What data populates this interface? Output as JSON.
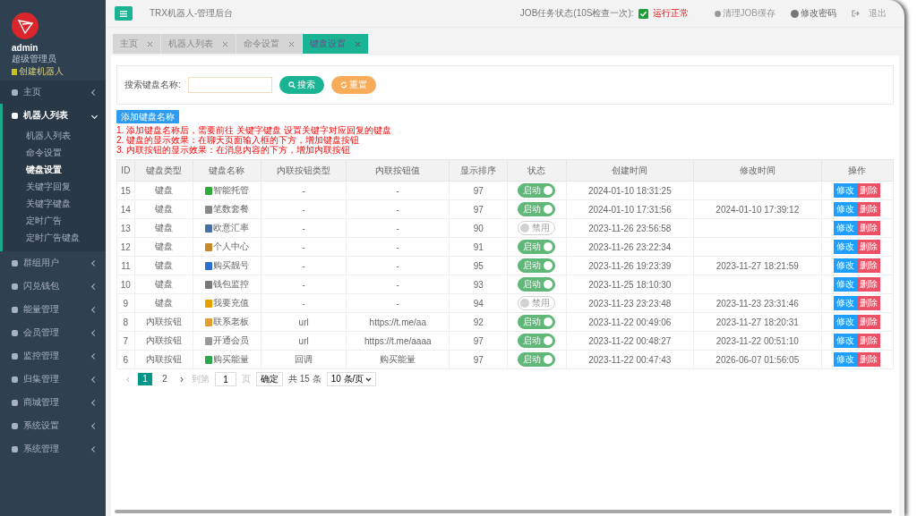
{
  "sidebar": {
    "user": {
      "name": "admin",
      "role": "超级管理员",
      "link": "创建机器人"
    },
    "items": [
      {
        "label": "主页",
        "expanded": false
      },
      {
        "label": "机器人列表",
        "expanded": true,
        "children": [
          {
            "label": "机器人列表",
            "selected": false
          },
          {
            "label": "命令设置",
            "selected": false
          },
          {
            "label": "键盘设置",
            "selected": true
          },
          {
            "label": "关键字回复",
            "selected": false
          },
          {
            "label": "关键字键盘",
            "selected": false
          },
          {
            "label": "定时广告",
            "selected": false
          },
          {
            "label": "定时广告键盘",
            "selected": false
          }
        ]
      },
      {
        "label": "群组用户",
        "expanded": false
      },
      {
        "label": "闪兑钱包",
        "expanded": false
      },
      {
        "label": "能量管理",
        "expanded": false
      },
      {
        "label": "会员管理",
        "expanded": false
      },
      {
        "label": "监控管理",
        "expanded": false
      },
      {
        "label": "归集管理",
        "expanded": false
      },
      {
        "label": "商城管理",
        "expanded": false
      },
      {
        "label": "系统设置",
        "expanded": false
      },
      {
        "label": "系统管理",
        "expanded": false
      }
    ]
  },
  "header": {
    "title": "TRX机器人-管理后台",
    "job_label": "JOB任务状态(10S检查一次):",
    "job_ok": true,
    "job_status": "运行正常",
    "clear_cache": "清理JOB缓存",
    "change_password": "修改密码",
    "logout": "退出"
  },
  "tabs": [
    {
      "label": "主页",
      "selected": false
    },
    {
      "label": "机器人列表",
      "selected": false
    },
    {
      "label": "命令设置",
      "selected": false
    },
    {
      "label": "键盘设置",
      "selected": true
    }
  ],
  "search": {
    "label": "搜索键盘名称:",
    "search_button": "搜索",
    "reset_button": "重置"
  },
  "add_button": "添加键盘名称",
  "notes": [
    "1. 添加键盘名称后，需要前往 关键字键盘 设置关键字对应回复的键盘",
    "2. 键盘的显示效果：在聊天页面输入框的下方，增加键盘按钮",
    "3. 内联按钮的显示效果：在消息内容的下方，增加内联按钮"
  ],
  "table": {
    "columns": [
      "ID",
      "键盘类型",
      "键盘名称",
      "内联按钮类型",
      "内联按钮值",
      "显示排序",
      "状态",
      "创建时间",
      "修改时间",
      "操作"
    ],
    "rows": [
      {
        "id": "15",
        "type": "键盘",
        "name": "智能托管",
        "button_type": "-",
        "button_value": "-",
        "order": "97",
        "on": true,
        "status": "启动",
        "created": "2024-01-10 18:31:25",
        "modified": "",
        "edit": "修改",
        "delete": "删除"
      },
      {
        "id": "14",
        "type": "键盘",
        "name": "笔数套餐",
        "button_type": "-",
        "button_value": "-",
        "order": "97",
        "on": true,
        "status": "启动",
        "created": "2024-01-10 17:31:56",
        "modified": "2024-01-10 17:39:12",
        "edit": "修改",
        "delete": "删除"
      },
      {
        "id": "13",
        "type": "键盘",
        "name": "欧意汇率",
        "button_type": "-",
        "button_value": "-",
        "order": "90",
        "on": false,
        "status": "禁用",
        "created": "2023-11-26 23:56:58",
        "modified": "",
        "edit": "修改",
        "delete": "删除"
      },
      {
        "id": "12",
        "type": "键盘",
        "name": "个人中心",
        "button_type": "-",
        "button_value": "-",
        "order": "91",
        "on": true,
        "status": "启动",
        "created": "2023-11-26 23:22:34",
        "modified": "",
        "edit": "修改",
        "delete": "删除"
      },
      {
        "id": "11",
        "type": "键盘",
        "name": "购买靓号",
        "button_type": "-",
        "button_value": "-",
        "order": "95",
        "on": true,
        "status": "启动",
        "created": "2023-11-26 19:23:39",
        "modified": "2023-11-27 18:21:59",
        "edit": "修改",
        "delete": "删除"
      },
      {
        "id": "10",
        "type": "键盘",
        "name": "钱包监控",
        "button_type": "-",
        "button_value": "-",
        "order": "93",
        "on": true,
        "status": "启动",
        "created": "2023-11-25 18:10:30",
        "modified": "",
        "edit": "修改",
        "delete": "删除"
      },
      {
        "id": "9",
        "type": "键盘",
        "name": "我要充值",
        "button_type": "-",
        "button_value": "-",
        "order": "94",
        "on": false,
        "status": "禁用",
        "created": "2023-11-23 23:23:48",
        "modified": "2023-11-23 23:31:46",
        "edit": "修改",
        "delete": "删除"
      },
      {
        "id": "8",
        "type": "内联按钮",
        "name": "联系老板",
        "button_type": "url",
        "button_value": "https://t.me/aa",
        "order": "92",
        "on": true,
        "status": "启动",
        "created": "2023-11-22 00:49:06",
        "modified": "2023-11-27 18:20:31",
        "edit": "修改",
        "delete": "删除"
      },
      {
        "id": "7",
        "type": "内联按钮",
        "name": "开通会员",
        "button_type": "url",
        "button_value": "https://t.me/aaaa",
        "order": "97",
        "on": true,
        "status": "启动",
        "created": "2023-11-22 00:48:27",
        "modified": "2023-11-22 00:51:10",
        "edit": "修改",
        "delete": "删除"
      },
      {
        "id": "6",
        "type": "内联按钮",
        "name": "购买能量",
        "button_type": "回调",
        "button_value": "购买能量",
        "order": "97",
        "on": true,
        "status": "启动",
        "created": "2023-11-22 00:47:43",
        "modified": "2026-06-07 01:56:05",
        "edit": "修改",
        "delete": "删除"
      }
    ]
  },
  "pagination": {
    "prev": "‹",
    "pages": [
      {
        "label": "1",
        "selected": true
      },
      {
        "label": "2",
        "selected": false
      }
    ],
    "next": "›",
    "goto": "到第",
    "page_value": "1",
    "page_unit": "页",
    "confirm": "确定",
    "total": "共 15 条",
    "page_size": "10 条/页"
  }
}
